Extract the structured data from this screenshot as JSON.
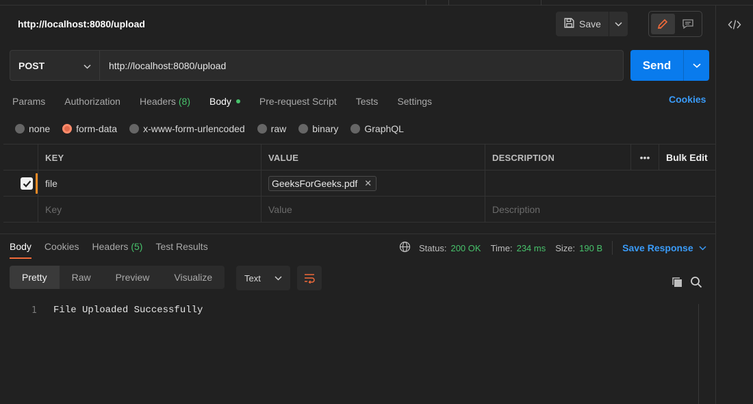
{
  "request": {
    "title": "http://localhost:8080/upload",
    "method": "POST",
    "url": "http://localhost:8080/upload"
  },
  "toolbar": {
    "save_label": "Save",
    "send_label": "Send"
  },
  "request_tabs": [
    {
      "label": "Params"
    },
    {
      "label": "Authorization"
    },
    {
      "label": "Headers",
      "count": "(8)"
    },
    {
      "label": "Body"
    },
    {
      "label": "Pre-request Script"
    },
    {
      "label": "Tests"
    },
    {
      "label": "Settings"
    }
  ],
  "cookies_label": "Cookies",
  "body_types": [
    {
      "label": "none"
    },
    {
      "label": "form-data",
      "selected": true
    },
    {
      "label": "x-www-form-urlencoded"
    },
    {
      "label": "raw"
    },
    {
      "label": "binary"
    },
    {
      "label": "GraphQL"
    }
  ],
  "table": {
    "headers": {
      "key": "KEY",
      "value": "VALUE",
      "description": "DESCRIPTION",
      "more": "•••",
      "bulk_edit": "Bulk Edit"
    },
    "rows": [
      {
        "key": "file",
        "value": "GeeksForGeeks.pdf",
        "checked": true
      }
    ],
    "placeholders": {
      "key": "Key",
      "value": "Value",
      "description": "Description"
    }
  },
  "response": {
    "tabs": [
      {
        "label": "Body"
      },
      {
        "label": "Cookies"
      },
      {
        "label": "Headers",
        "count": "(5)"
      },
      {
        "label": "Test Results"
      }
    ],
    "status_label": "Status:",
    "status_value": "200 OK",
    "time_label": "Time:",
    "time_value": "234 ms",
    "size_label": "Size:",
    "size_value": "190 B",
    "save_response": "Save Response",
    "view_modes": [
      "Pretty",
      "Raw",
      "Preview",
      "Visualize"
    ],
    "format": "Text",
    "lines": [
      {
        "num": "1",
        "text": "File Uploaded Successfully"
      }
    ]
  },
  "colors": {
    "accent_blue": "#097bed",
    "link_blue": "#3a9bf8",
    "success_green": "#47c26b",
    "active_orange": "#f26b3a"
  }
}
